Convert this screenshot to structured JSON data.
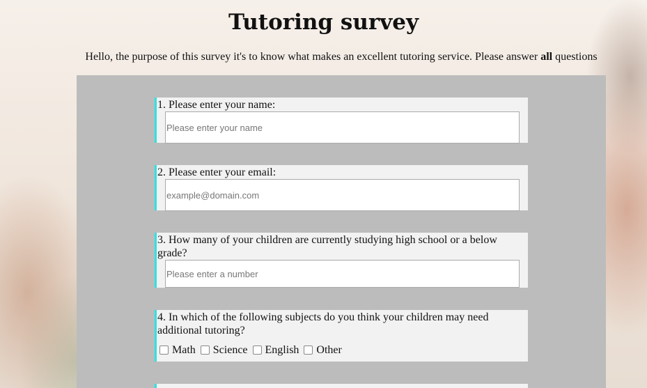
{
  "page": {
    "title": "Tutoring survey",
    "intro_before": "Hello, the purpose of this survey it's to know what makes an excellent tutoring service. Please answer ",
    "intro_bold": "all",
    "intro_after": " questions"
  },
  "questions": {
    "q1": {
      "label": "1. Please enter your name:",
      "placeholder": "Please enter your name"
    },
    "q2": {
      "label": "2. Please enter your email:",
      "placeholder": "example@domain.com"
    },
    "q3": {
      "label": "3. How many of your children are currently studying high school or a below grade?",
      "placeholder": "Please enter a number"
    },
    "q4": {
      "label": "4. In which of the following subjects do you think your children may need additional tutoring?",
      "options": [
        "Math",
        "Science",
        "English",
        "Other"
      ]
    }
  },
  "colors": {
    "panel_bg": "#bcbcbc",
    "question_bg": "#f2f2f2",
    "accent_border": "#2de3e3"
  }
}
